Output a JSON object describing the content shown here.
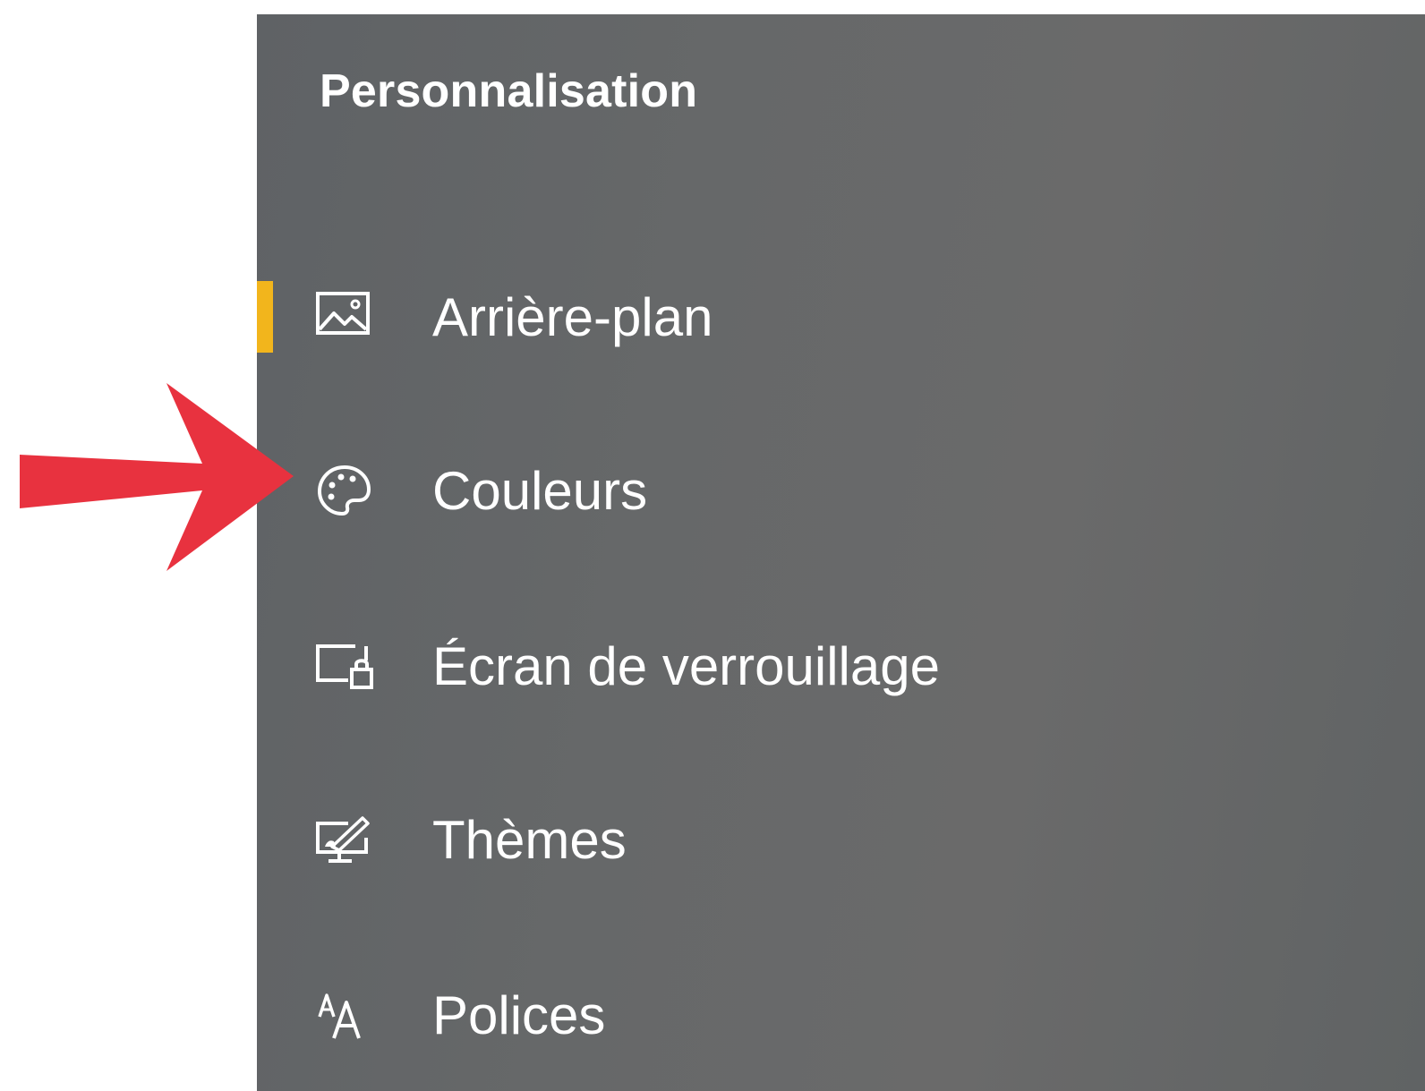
{
  "panel": {
    "title": "Personnalisation"
  },
  "nav": {
    "items": [
      {
        "label": "Arrière-plan",
        "icon": "image-icon",
        "selected": true
      },
      {
        "label": "Couleurs",
        "icon": "palette-icon",
        "selected": false
      },
      {
        "label": "Écran de verrouillage",
        "icon": "lock-screen-icon",
        "selected": false
      },
      {
        "label": "Thèmes",
        "icon": "themes-icon",
        "selected": false
      },
      {
        "label": "Polices",
        "icon": "fonts-icon",
        "selected": false
      }
    ]
  },
  "colors": {
    "accent": "#f2b51c",
    "annotation_arrow": "#e8323f",
    "panel_background": "#666869",
    "text": "#ffffff"
  }
}
